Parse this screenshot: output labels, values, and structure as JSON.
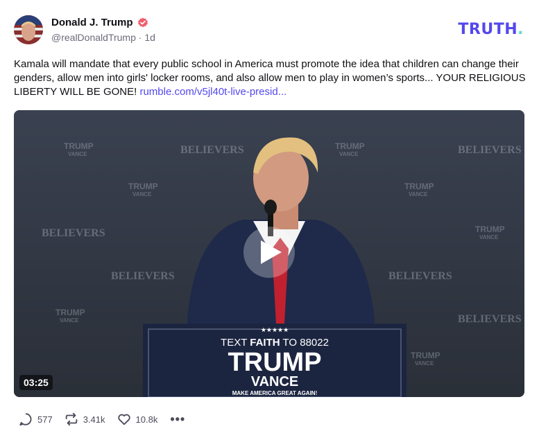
{
  "author": {
    "display_name": "Donald J. Trump",
    "handle": "@realDonaldTrump",
    "separator": "·",
    "time": "1d"
  },
  "brand": {
    "logo_main": "TRUTH",
    "logo_dot": "."
  },
  "post": {
    "text": "Kamala will mandate that every public school in America must promote the idea that children can change their genders, allow men into girls' locker rooms, and also allow men to play in women’s sports... YOUR RELIGIOUS LIBERTY WILL BE GONE! ",
    "link_text": "rumble.com/v5jl40t-live-presid..."
  },
  "video": {
    "duration": "03:25",
    "backdrop_text": [
      "BELIEVERS",
      "TRUMP",
      "VANCE"
    ],
    "podium": {
      "stars": "★★★★★",
      "line1_pre": "TEXT ",
      "line1_bold": "FAITH",
      "line1_post": " TO 88022",
      "line2": "TRUMP",
      "line3": "VANCE",
      "line4": "MAKE AMERICA GREAT AGAIN!"
    }
  },
  "actions": {
    "replies": "577",
    "retruths": "3.41k",
    "likes": "10.8k",
    "more": "•••"
  },
  "colors": {
    "brand_purple": "#5448ee",
    "brand_teal": "#53e0c4",
    "verified": "#f25d6e"
  }
}
